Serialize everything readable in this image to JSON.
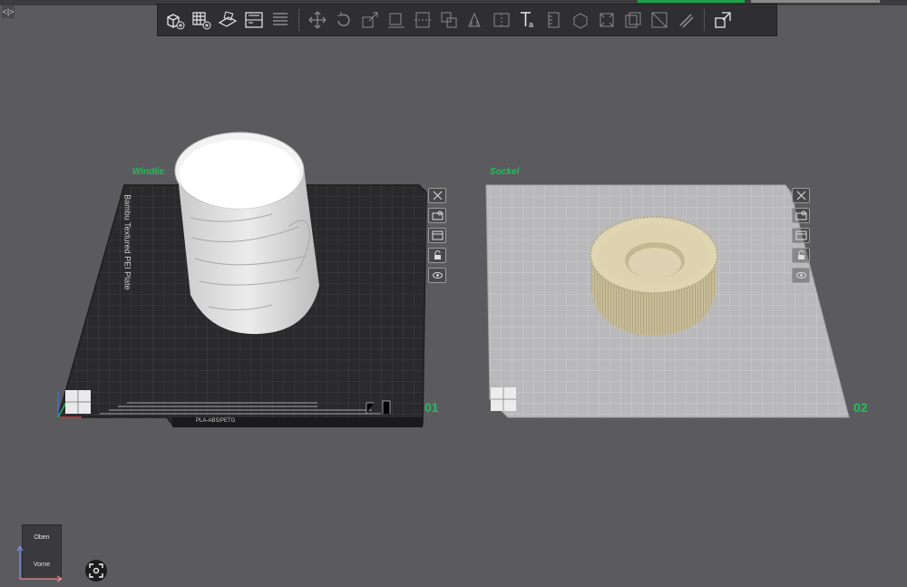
{
  "window": {
    "collapse_label": "<|>"
  },
  "toolbar": {
    "items": [
      {
        "name": "add-object-icon"
      },
      {
        "name": "add-plate-icon"
      },
      {
        "name": "auto-orient-icon"
      },
      {
        "name": "arrange-icon"
      },
      {
        "name": "split-icon"
      },
      {
        "name": "move-icon"
      },
      {
        "name": "rotate-icon"
      },
      {
        "name": "scale-icon"
      },
      {
        "name": "lay-on-face-icon"
      },
      {
        "name": "cut-icon"
      },
      {
        "name": "mesh-boolean-icon"
      },
      {
        "name": "support-paint-icon"
      },
      {
        "name": "seam-paint-icon"
      },
      {
        "name": "text-icon",
        "glyph": "Ta"
      },
      {
        "name": "measure-icon"
      },
      {
        "name": "assembly-icon"
      },
      {
        "name": "emboss-icon"
      },
      {
        "name": "variable-layer-icon"
      },
      {
        "name": "color-paint-icon"
      },
      {
        "name": "fuzzy-skin-icon"
      },
      {
        "name": "plate-settings-icon"
      }
    ]
  },
  "plates": [
    {
      "label": "Windlic",
      "number": "01",
      "bed_text": "Bambu Textured PEI Plate",
      "filament_text": "PLA-ABS/PETG",
      "object": "Windlicht",
      "colors": {
        "bed": "#2a2a2c",
        "grid": "#4a4a4e",
        "object": "#dcdcdc"
      }
    },
    {
      "label": "Sockel",
      "number": "02",
      "object": "Sockel",
      "colors": {
        "bed": "#b9b9bb",
        "grid": "#d5d5d7",
        "object": "#cbbf9c"
      }
    }
  ],
  "plate_actions": [
    {
      "name": "delete-plate-icon"
    },
    {
      "name": "auto-arrange-plate-icon"
    },
    {
      "name": "plate-settings-icon"
    },
    {
      "name": "lock-plate-icon"
    },
    {
      "name": "show-plate-icon"
    }
  ],
  "navcube": {
    "top_label": "Oben",
    "front_label": "Vorne"
  },
  "accent_color": "#1fbf58"
}
